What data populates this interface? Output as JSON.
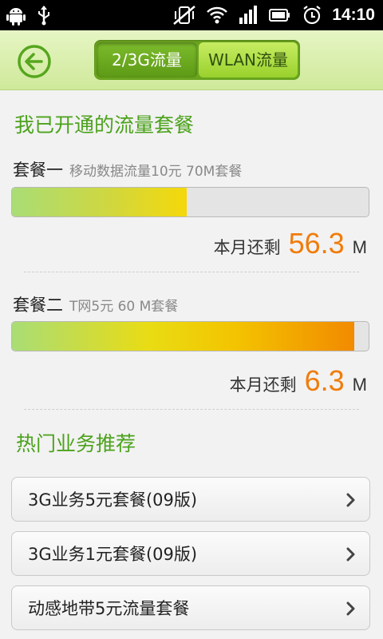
{
  "status_bar": {
    "time": "14:10"
  },
  "header": {
    "tabs": [
      {
        "label": "2/3G流量",
        "active": true
      },
      {
        "label": "WLAN流量",
        "active": false
      }
    ]
  },
  "my_plans": {
    "title": "我已开通的流量套餐",
    "plans": [
      {
        "name": "套餐一",
        "desc": "移动数据流量10元 70M套餐",
        "remaining_label": "本月还剩",
        "remaining_value": "56.3",
        "unit": "M",
        "used_fraction": 0.49
      },
      {
        "name": "套餐二",
        "desc": "T网5元 60 M套餐",
        "remaining_label": "本月还剩",
        "remaining_value": "6.3",
        "unit": "M",
        "used_fraction": 0.96
      }
    ]
  },
  "recommend": {
    "title": "热门业务推荐",
    "items": [
      {
        "label": "3G业务5元套餐(09版)"
      },
      {
        "label": "3G业务1元套餐(09版)"
      },
      {
        "label": "动感地带5元流量套餐"
      }
    ]
  },
  "colors": {
    "accent_green": "#4ca21c",
    "remain_orange": "#f07c0a",
    "tab_green": "#6aa51e"
  }
}
